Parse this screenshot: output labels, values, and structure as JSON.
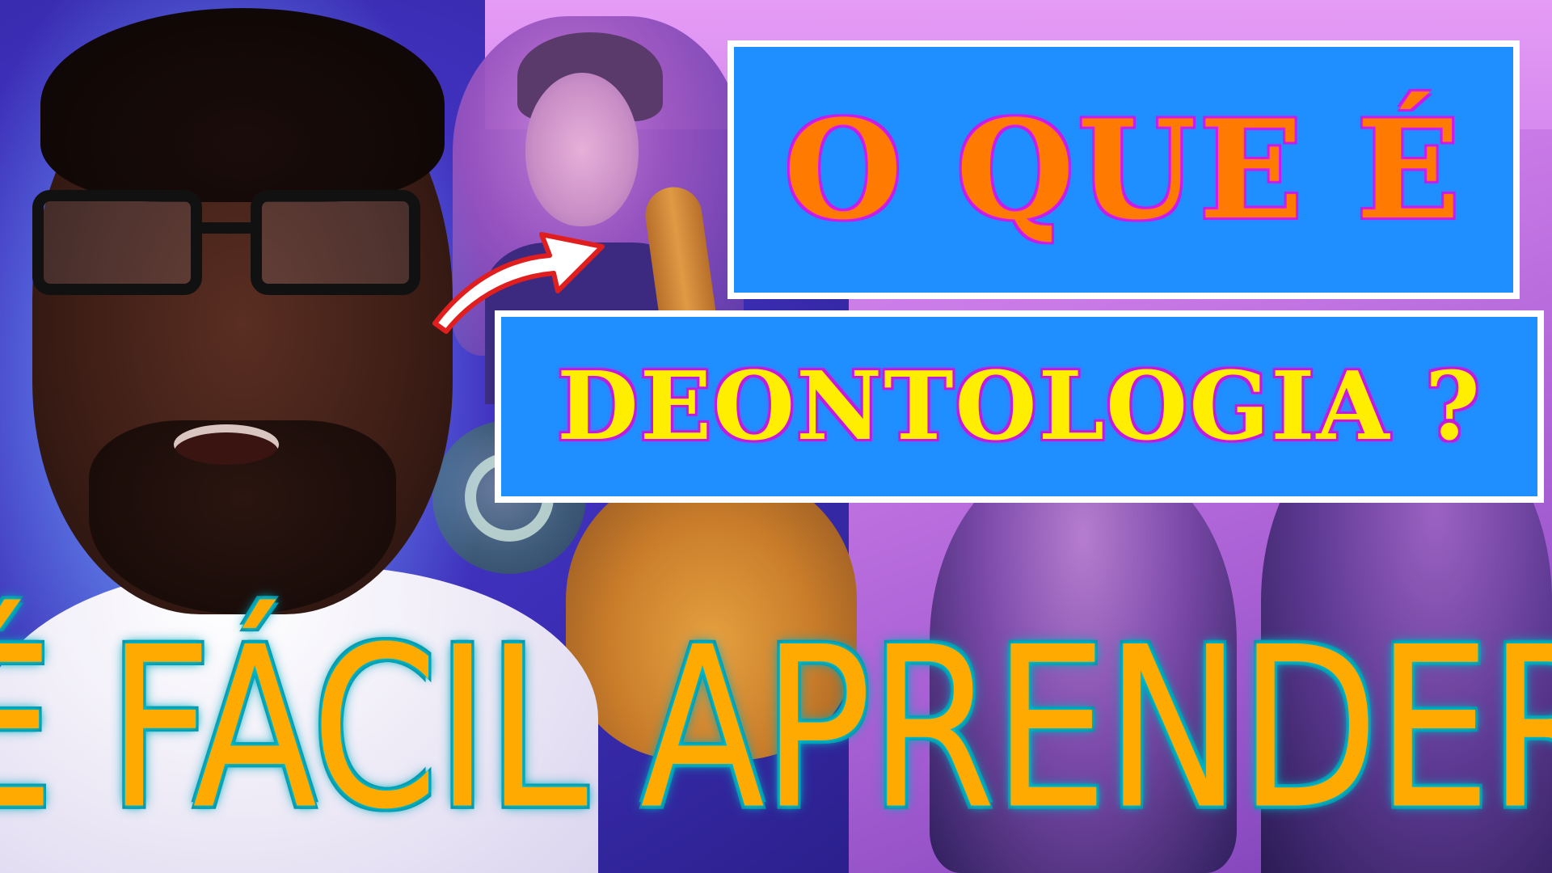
{
  "headline": {
    "line1": "O QUE É",
    "line2": "DEONTOLOGIA ?"
  },
  "banner": {
    "text": "É FÁCIL APRENDER"
  },
  "colors": {
    "box_fill": "#1f8fff",
    "box_border": "#ffffff",
    "line1_text": "#ff7a00",
    "line2_text": "#ffee00",
    "text_outline": "#c41ae0",
    "banner_text": "#ffaa00",
    "banner_outline": "#00c2d6",
    "arrow": "#e01e1e"
  },
  "icons": {
    "arrow": "curved-arrow-icon",
    "whatsapp": "whatsapp-icon"
  }
}
